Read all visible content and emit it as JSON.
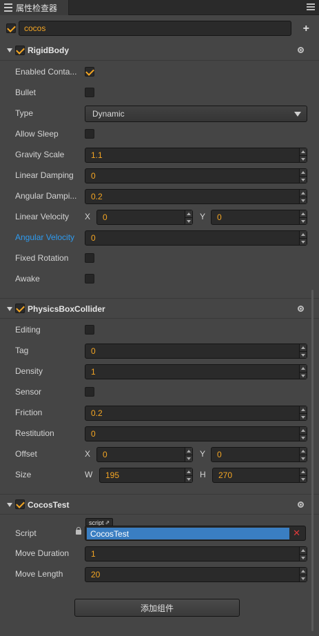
{
  "panel": {
    "tab_title": "属性检查器"
  },
  "node": {
    "enabled": true,
    "name": "cocos"
  },
  "rigid_body": {
    "title": "RigidBody",
    "enabled": true,
    "labels": {
      "enabled_contact": "Enabled Conta...",
      "bullet": "Bullet",
      "type": "Type",
      "allow_sleep": "Allow Sleep",
      "gravity_scale": "Gravity Scale",
      "linear_damping": "Linear Damping",
      "angular_damping": "Angular Dampi...",
      "linear_velocity": "Linear Velocity",
      "angular_velocity": "Angular Velocity",
      "fixed_rotation": "Fixed Rotation",
      "awake": "Awake"
    },
    "values": {
      "enabled_contact": true,
      "bullet": false,
      "type": "Dynamic",
      "allow_sleep": false,
      "gravity_scale": "1.1",
      "linear_damping": "0",
      "angular_damping": "0.2",
      "linear_velocity_x": "0",
      "linear_velocity_y": "0",
      "angular_velocity": "0",
      "fixed_rotation": false,
      "awake": false
    },
    "highlight_color": "#2e9bf0"
  },
  "box_collider": {
    "title": "PhysicsBoxCollider",
    "enabled": true,
    "labels": {
      "editing": "Editing",
      "tag": "Tag",
      "density": "Density",
      "sensor": "Sensor",
      "friction": "Friction",
      "restitution": "Restitution",
      "offset": "Offset",
      "size": "Size"
    },
    "values": {
      "editing": false,
      "tag": "0",
      "density": "1",
      "sensor": false,
      "friction": "0.2",
      "restitution": "0",
      "offset_x": "0",
      "offset_y": "0",
      "size_w": "195",
      "size_h": "270"
    }
  },
  "cocos_test": {
    "title": "CocosTest",
    "enabled": true,
    "script_tag": "script",
    "labels": {
      "script": "Script",
      "move_duration": "Move Duration",
      "move_length": "Move Length"
    },
    "values": {
      "script": "CocosTest",
      "move_duration": "1",
      "move_length": "20"
    }
  },
  "axes": {
    "x": "X",
    "y": "Y",
    "w": "W",
    "h": "H"
  },
  "add_component_label": "添加组件",
  "colors": {
    "accent": "#f5a623",
    "background": "#454545",
    "script_selected": "#3a7ec2",
    "remove": "#e03a3a"
  }
}
